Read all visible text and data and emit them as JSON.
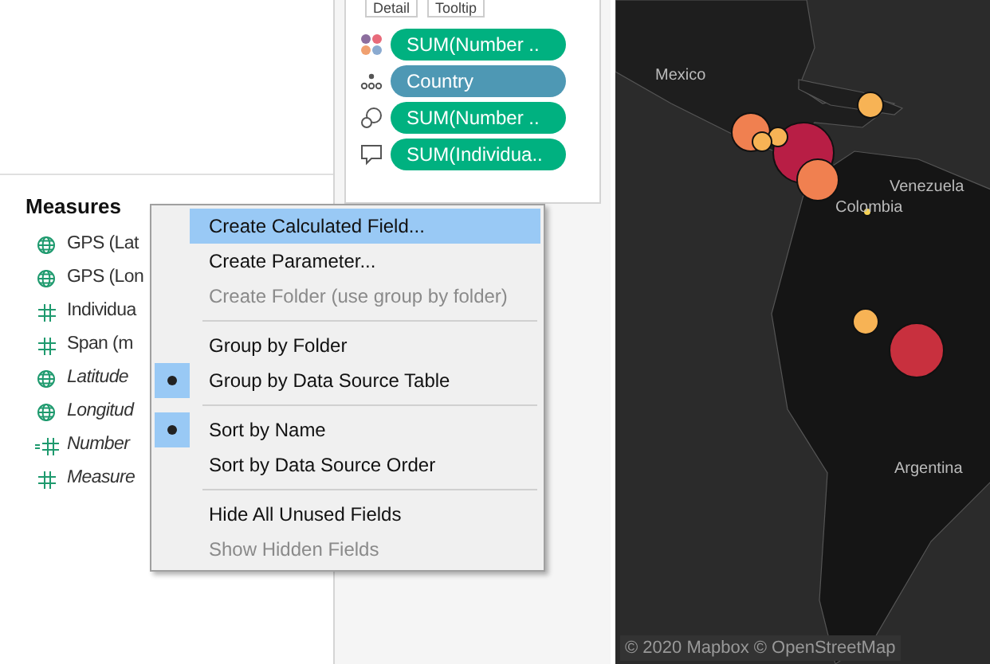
{
  "marks_card": {
    "buttons": [
      {
        "label": "Detail"
      },
      {
        "label": "Tooltip"
      }
    ],
    "pills": [
      {
        "kind": "color",
        "label": "SUM(Number ..",
        "color": "#00b180"
      },
      {
        "kind": "detail",
        "label": "Country",
        "color": "#4e98b4"
      },
      {
        "kind": "size",
        "label": "SUM(Number ..",
        "color": "#00b180"
      },
      {
        "kind": "tooltip",
        "label": "SUM(Individua..",
        "color": "#00b180"
      }
    ]
  },
  "data_pane": {
    "title": "Measures",
    "fields": [
      {
        "kind": "geo",
        "label": "GPS (Lat",
        "italic": false
      },
      {
        "kind": "geo",
        "label": "GPS (Lon",
        "italic": false
      },
      {
        "kind": "number",
        "label": "Individua",
        "italic": false
      },
      {
        "kind": "number",
        "label": "Span (m",
        "italic": false
      },
      {
        "kind": "geo",
        "label": "Latitude",
        "italic": true
      },
      {
        "kind": "geo",
        "label": "Longitud",
        "italic": true
      },
      {
        "kind": "calculated",
        "label": "Number",
        "italic": true
      },
      {
        "kind": "number",
        "label": "Measure",
        "italic": true
      }
    ]
  },
  "context_menu": [
    {
      "kind": "item",
      "label": "Create Calculated Field...",
      "highlighted": true,
      "disabled": false,
      "checked": false
    },
    {
      "kind": "item",
      "label": "Create Parameter...",
      "highlighted": false,
      "disabled": false,
      "checked": false
    },
    {
      "kind": "item",
      "label": "Create Folder (use group by folder)",
      "highlighted": false,
      "disabled": true,
      "checked": false
    },
    {
      "kind": "separator"
    },
    {
      "kind": "item",
      "label": "Group by Folder",
      "highlighted": false,
      "disabled": false,
      "checked": false
    },
    {
      "kind": "item",
      "label": "Group by Data Source Table",
      "highlighted": false,
      "disabled": false,
      "checked": true
    },
    {
      "kind": "separator"
    },
    {
      "kind": "item",
      "label": "Sort by Name",
      "highlighted": false,
      "disabled": false,
      "checked": true
    },
    {
      "kind": "item",
      "label": "Sort by Data Source Order",
      "highlighted": false,
      "disabled": false,
      "checked": false
    },
    {
      "kind": "separator"
    },
    {
      "kind": "item",
      "label": "Hide All Unused Fields",
      "highlighted": false,
      "disabled": false,
      "checked": false
    },
    {
      "kind": "item",
      "label": "Show Hidden Fields",
      "highlighted": false,
      "disabled": true,
      "checked": false
    }
  ],
  "map": {
    "labels": [
      "Mexico",
      "Venezuela",
      "Colombia",
      "Argentina"
    ],
    "attribution": "© 2020 Mapbox © OpenStreetMap"
  }
}
